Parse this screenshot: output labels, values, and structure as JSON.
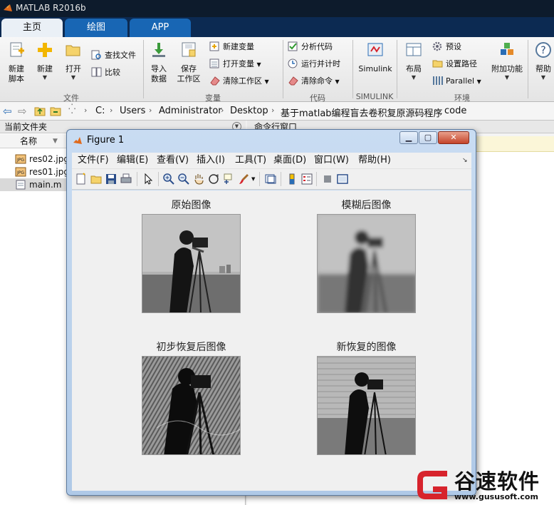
{
  "window": {
    "title": "MATLAB R2016b"
  },
  "tabs": [
    {
      "label": "主页",
      "active": true
    },
    {
      "label": "绘图",
      "active": false
    },
    {
      "label": "APP",
      "active": false
    }
  ],
  "ribbon": {
    "new_script": "新建\n脚本",
    "new": "新建",
    "open": "打开",
    "find_files": "查找文件",
    "compare": "比较",
    "import_data": "导入\n数据",
    "save_workspace": "保存\n工作区",
    "new_variable": "新建变量",
    "open_variable": "打开变量",
    "clear_workspace": "清除工作区",
    "analyze_code": "分析代码",
    "run_and_time": "运行并计时",
    "clear_commands": "清除命令",
    "simulink": "Simulink",
    "layout": "布局",
    "preferences": "预设",
    "set_path": "设置路径",
    "parallel": "Parallel",
    "addons": "附加功能",
    "help": "帮助",
    "sections": {
      "file": "文件",
      "variable": "变量",
      "code": "代码",
      "simulink": "SIMULINK",
      "environment": "环境"
    }
  },
  "address": {
    "crumbs": [
      "C:",
      "Users",
      "Administrator",
      "Desktop",
      "基于matlab编程盲去卷积复原源码程序",
      "code"
    ]
  },
  "left_panel": {
    "title": "当前文件夹",
    "col_name": "名称",
    "files": [
      {
        "name": "res02.jpg",
        "icon": "jpg-file-icon"
      },
      {
        "name": "res01.jpg",
        "icon": "jpg-file-icon"
      },
      {
        "name": "main.m",
        "icon": "m-file-icon",
        "selected": true
      }
    ]
  },
  "command_window": {
    "title": "命令行窗口"
  },
  "figure": {
    "title": "Figure 1",
    "menu": [
      "文件(F)",
      "编辑(E)",
      "查看(V)",
      "插入(I)",
      "工具(T)",
      "桌面(D)",
      "窗口(W)",
      "帮助(H)"
    ],
    "plots": [
      {
        "title": "原始图像"
      },
      {
        "title": "模糊后图像"
      },
      {
        "title": "初步恢复后图像"
      },
      {
        "title": "新恢复的图像"
      }
    ]
  },
  "watermark": {
    "brand": "谷速软件",
    "url": "www.gususoft.com"
  },
  "colors": {
    "accent": "#1866b4",
    "titlebar": "#0d1b2c",
    "tabstrip": "#0c2a52",
    "watermark_red": "#d7232c"
  }
}
